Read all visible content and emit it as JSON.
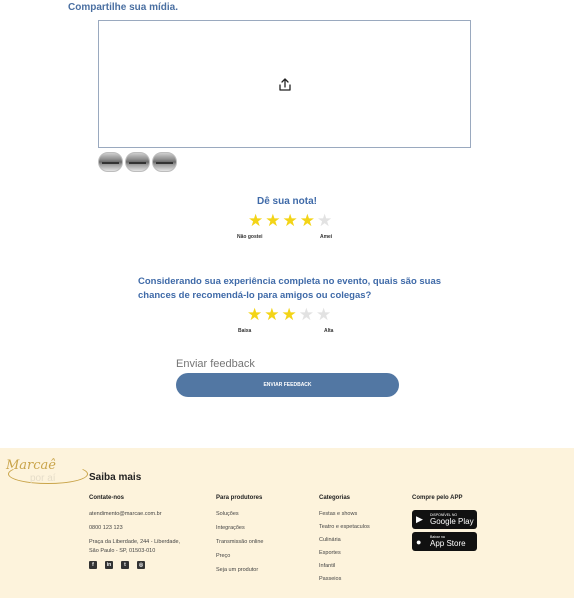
{
  "share": {
    "title": "Compartilhe sua mídia."
  },
  "upload": {
    "icon": "upload-icon"
  },
  "thumbnails": [
    "thumb-1",
    "thumb-2",
    "thumb-3"
  ],
  "rating": {
    "title": "Dê sua nota!",
    "value": 4,
    "max": 5,
    "min_label": "Não gostei",
    "max_label": "Amei"
  },
  "recommend": {
    "question": "Considerando sua experiência completa no evento, quais são suas chances de recomendá-lo para amigos ou colegas?",
    "value": 3,
    "max": 5,
    "min_label": "Baixa",
    "max_label": "Alta"
  },
  "feedback": {
    "placeholder": "Enviar feedback",
    "button_label": "ENVIAR FEEDBACK"
  },
  "footer": {
    "logo_text": "Marcaê",
    "logo_sub": "por aí",
    "saiba_mais": "Saiba mais",
    "contact": {
      "heading": "Contate-nos",
      "email": "atendimento@marcae.com.br",
      "phone": "0800 123 123",
      "address": "Praça da Liberdade, 244 - Liberdade, São Paulo - SP, 01503-010"
    },
    "social": [
      "facebook-icon",
      "linkedin-icon",
      "twitter-icon",
      "instagram-icon"
    ],
    "producers": {
      "heading": "Para produtores",
      "items": [
        "Soluções",
        "Integrações",
        "Transmissão online",
        "Preço",
        "Seja um produtor"
      ]
    },
    "categories": {
      "heading": "Categorias",
      "items": [
        "Festas e shows",
        "Teatro e espetaculos",
        "Culinária",
        "Esportes",
        "Infantil",
        "Passeios"
      ]
    },
    "app": {
      "heading": "Compre pelo APP",
      "google_small": "DISPONÍVEL NO",
      "google_big": "Google Play",
      "apple_small": "Baixar na",
      "apple_big": "App Store"
    }
  },
  "colors": {
    "accent": "#3f6aa8",
    "button": "#5277a3",
    "star_on": "#f3d417",
    "star_off": "#e2e2e2",
    "footer_bg": "#fdf3dc"
  }
}
